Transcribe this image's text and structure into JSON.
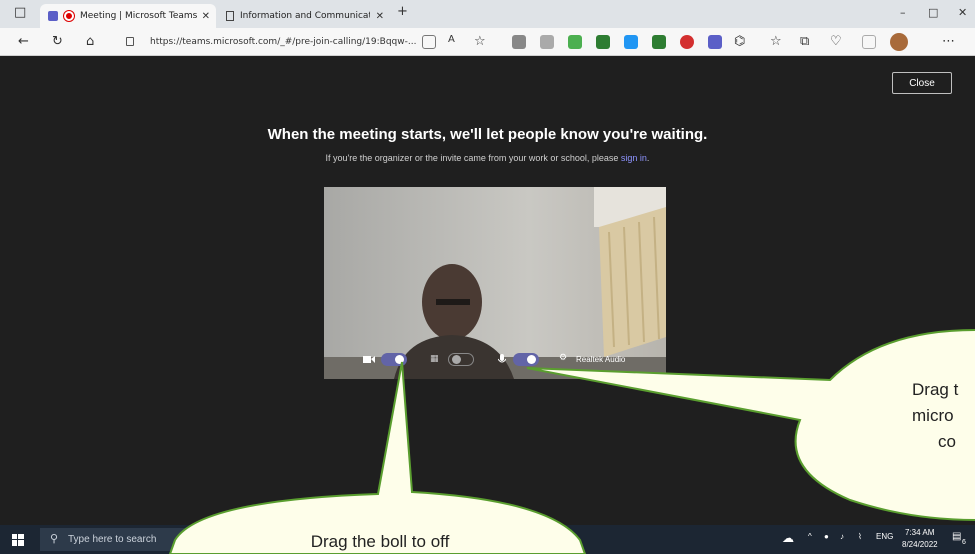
{
  "browser": {
    "tabs": [
      {
        "label": "Meeting | Microsoft Teams",
        "active": true
      },
      {
        "label": "Information and Communication",
        "active": false
      }
    ],
    "url": "https://teams.microsoft.com/_#/pre-join-calling/19:Bqqw-..."
  },
  "meeting": {
    "close_label": "Close",
    "headline": "When the meeting starts, we'll let people know you're waiting.",
    "subline_prefix": "If you're the organizer or the invite came from your work or school, please ",
    "subline_link": "sign in",
    "subline_suffix": ".",
    "controls": {
      "camera_on": true,
      "blur_on": false,
      "mic_on": true,
      "audio_device": "Realtek Audio"
    }
  },
  "taskbar": {
    "search_placeholder": "Type here to search",
    "language": "ENG",
    "time": "7:34 AM",
    "date": "8/24/2022",
    "notifications": "6"
  },
  "callouts": {
    "camera_hint": "Drag the boll to off",
    "mic_hint_line1": "Drag t",
    "mic_hint_line2": "micro",
    "mic_hint_line3": "co"
  },
  "colors": {
    "accent": "#6264a7",
    "callout_fill": "#fefeea",
    "callout_stroke": "#5a9e2f"
  }
}
